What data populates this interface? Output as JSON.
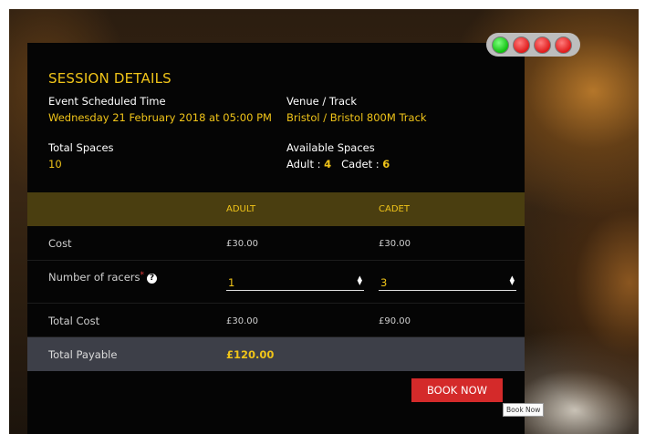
{
  "session": {
    "heading": "SESSION DETAILS",
    "event_time_label": "Event Scheduled Time",
    "event_time_value": "Wednesday 21 February 2018 at 05:00 PM",
    "venue_label": "Venue / Track",
    "venue_value": "Bristol / Bristol 800M Track",
    "total_spaces_label": "Total Spaces",
    "total_spaces_value": "10",
    "available_label": "Available Spaces",
    "adult_label": "Adult :",
    "adult_available": "4",
    "cadet_label": "Cadet :",
    "cadet_available": "6"
  },
  "table": {
    "columns": [
      "ADULT",
      "CADET"
    ],
    "cost_label": "Cost",
    "cost_adult": "£30.00",
    "cost_cadet": "£30.00",
    "racers_label": "Number of racers",
    "required_mark": "*",
    "help_icon": "?",
    "racers_adult": "1",
    "racers_cadet": "3",
    "total_cost_label": "Total Cost",
    "total_cost_adult": "£30.00",
    "total_cost_cadet": "£90.00",
    "payable_label": "Total Payable",
    "payable_value": "£120.00"
  },
  "actions": {
    "book_label": "BOOK NOW",
    "tooltip": "Book Now"
  },
  "icons": {
    "window_controls": [
      "green-circle-icon",
      "red-circle-icon",
      "red-circle-icon",
      "red-circle-icon"
    ],
    "help": "question-circle-icon",
    "stepper": "up-down-arrows-icon"
  },
  "colors": {
    "accent": "#f0c419",
    "button": "#d42a2a",
    "header_row": "#4a3e10",
    "payable_row": "#3d3f48"
  }
}
